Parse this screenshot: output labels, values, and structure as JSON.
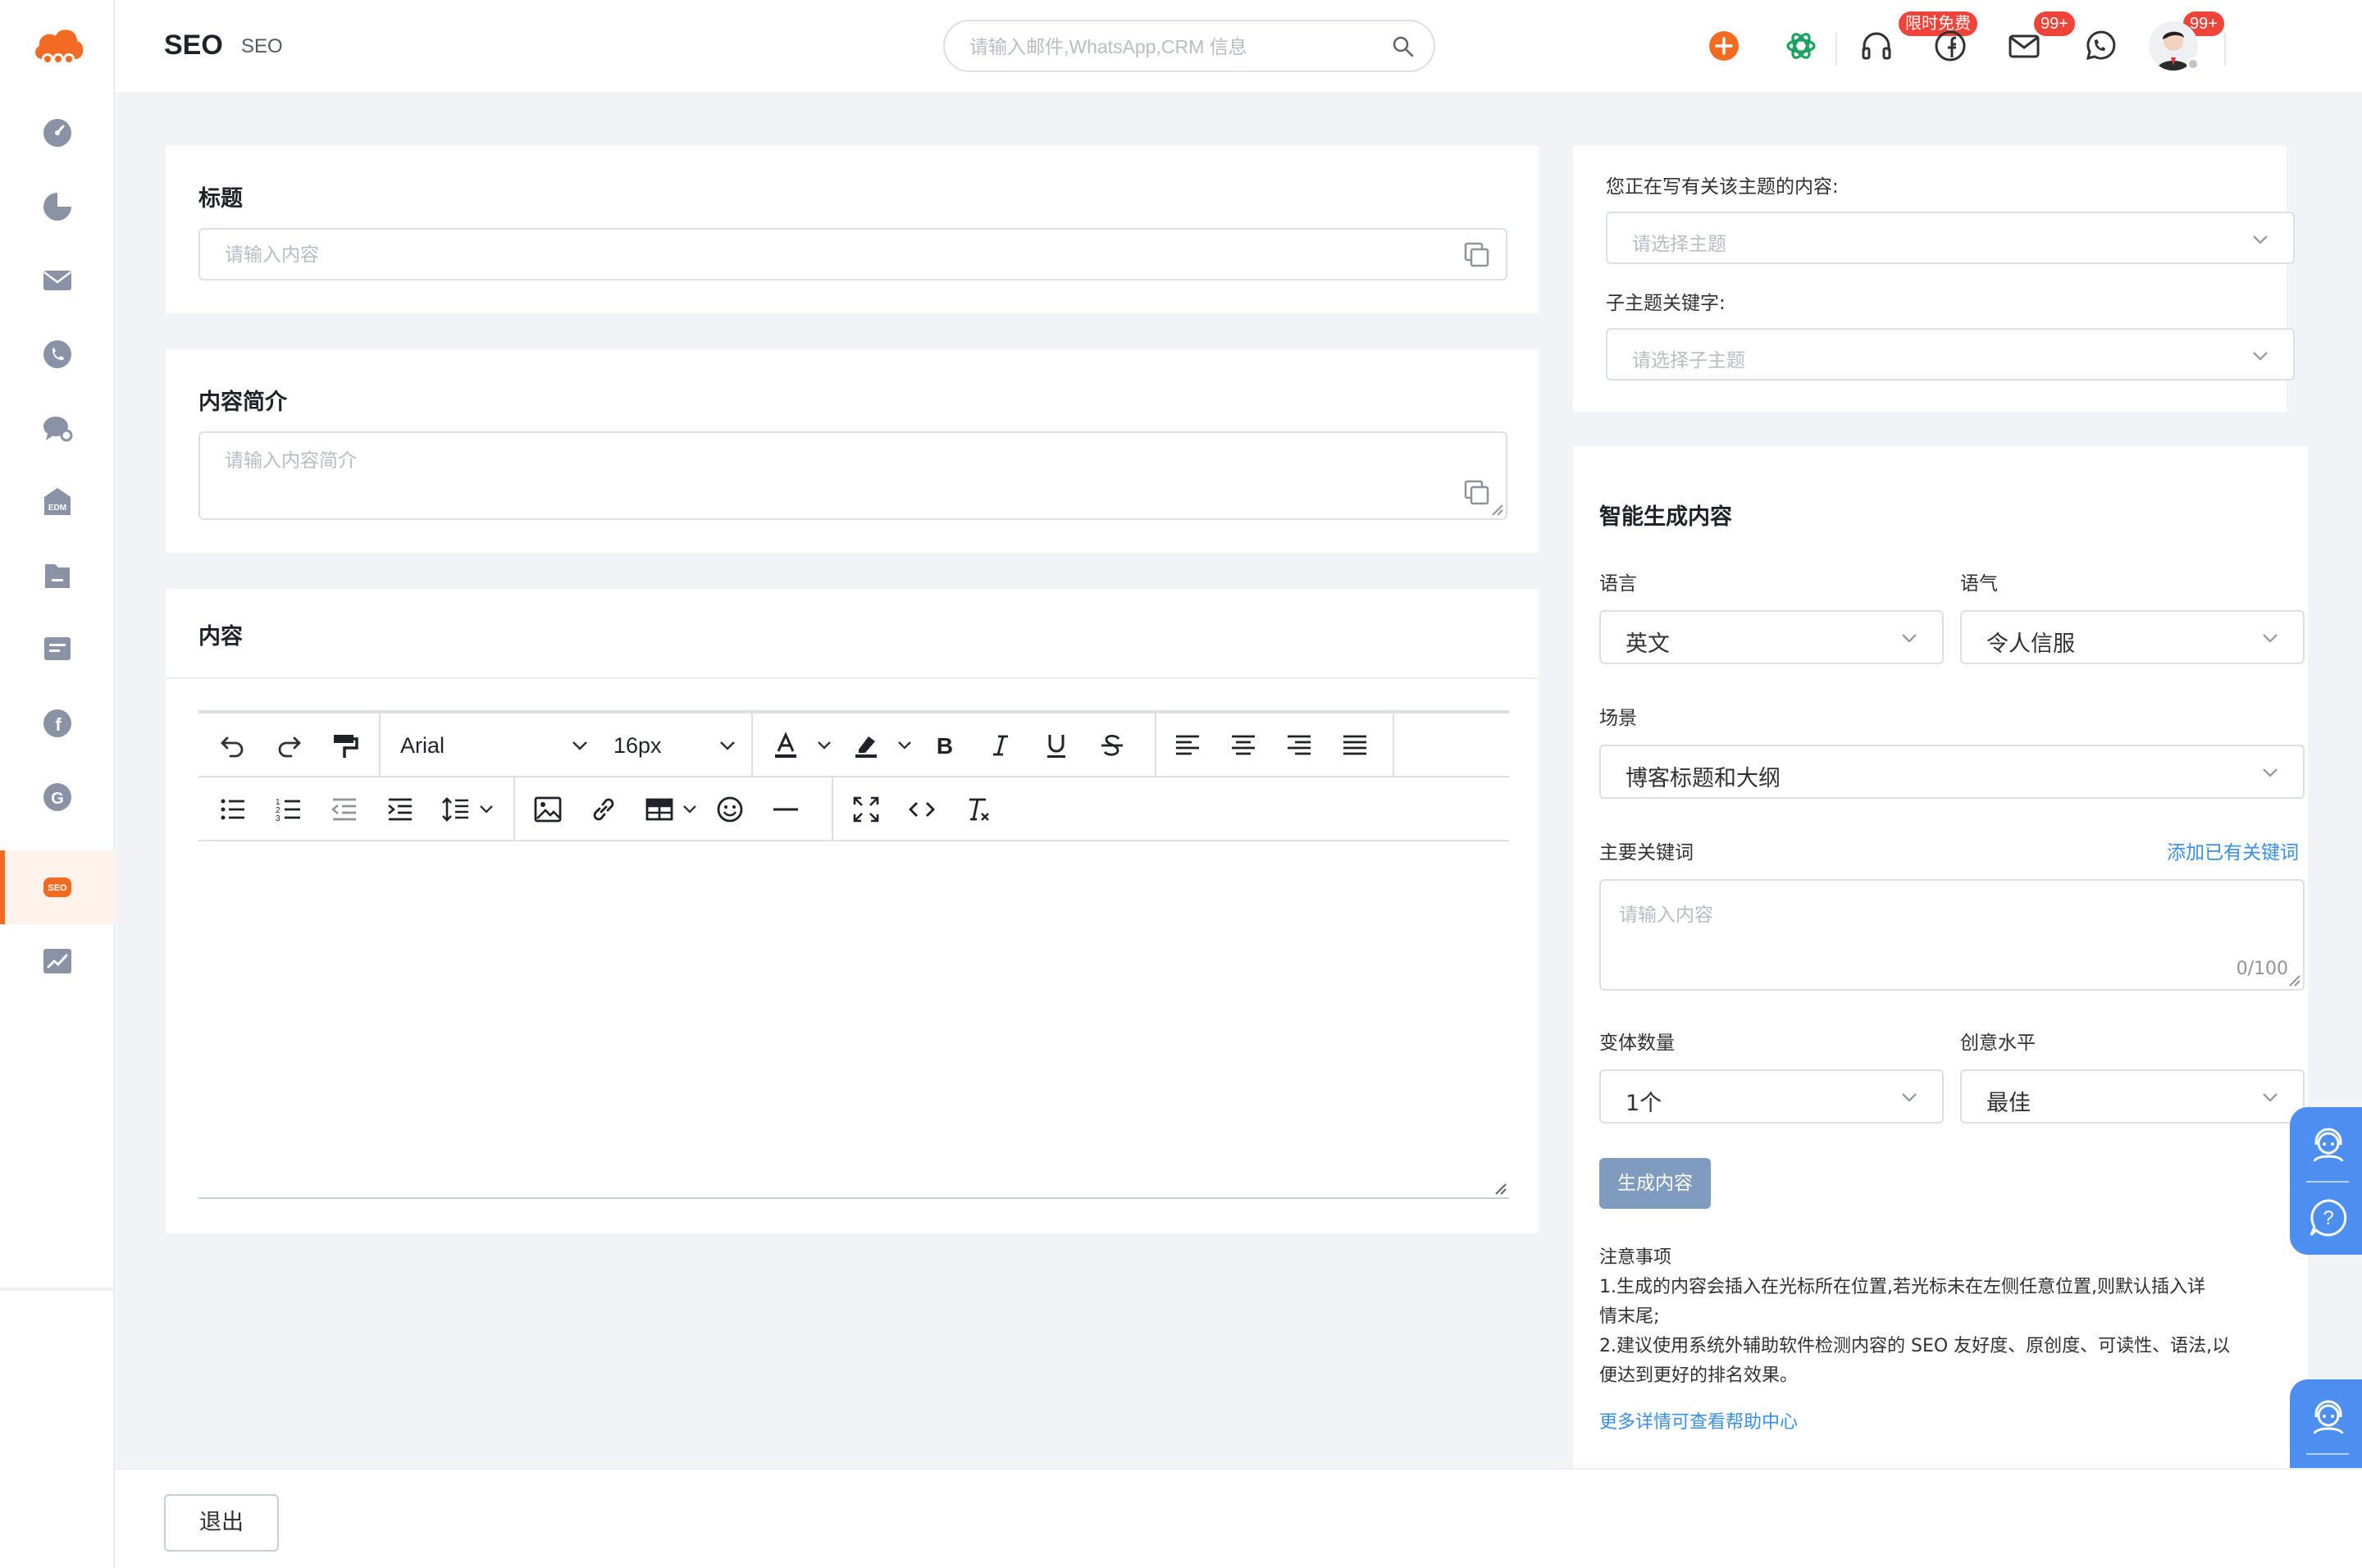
{
  "header": {
    "title": "SEO",
    "subtitle": "SEO",
    "search_placeholder": "请输入邮件,WhatsApp,CRM 信息",
    "free_badge": "限时免费",
    "mail_badge": "99+",
    "apps_badge": "99+"
  },
  "title_card": {
    "label": "标题",
    "placeholder": "请输入内容"
  },
  "summary_card": {
    "label": "内容简介",
    "placeholder": "请输入内容简介"
  },
  "content_card": {
    "label": "内容",
    "font_family": "Arial",
    "font_size": "16px"
  },
  "topic_panel": {
    "topic_label": "您正在写有关该主题的内容:",
    "topic_placeholder": "请选择主题",
    "subtopic_label": "子主题关键字:",
    "subtopic_placeholder": "请选择子主题"
  },
  "ai_panel": {
    "title": "智能生成内容",
    "language_label": "语言",
    "language_value": "英文",
    "tone_label": "语气",
    "tone_value": "令人信服",
    "scene_label": "场景",
    "scene_value": "博客标题和大纲",
    "keyword_label": "主要关键词",
    "add_keyword_link": "添加已有关键词",
    "keyword_placeholder": "请输入内容",
    "keyword_counter": "0/100",
    "variant_label": "变体数量",
    "variant_value": "1个",
    "creativity_label": "创意水平",
    "creativity_value": "最佳",
    "generate_button": "生成内容",
    "notes_title": "注意事项",
    "note_1": "1.生成的内容会插入在光标所在位置,若光标未在左侧任意位置,则默认插入详",
    "note_1b": "情末尾;",
    "note_2": "2.建议使用系统外辅助软件检测内容的 SEO 友好度、原创度、可读性、语法,以",
    "note_2b": "便达到更好的排名效果。",
    "help_link": "更多详情可查看帮助中心"
  },
  "footer": {
    "exit_button": "退出"
  },
  "colors": {
    "brand": "#f26b22",
    "accent_blue": "#3a8ee6",
    "generate_button": "#7f9bbd",
    "help_widget": "#4d8ff0"
  }
}
